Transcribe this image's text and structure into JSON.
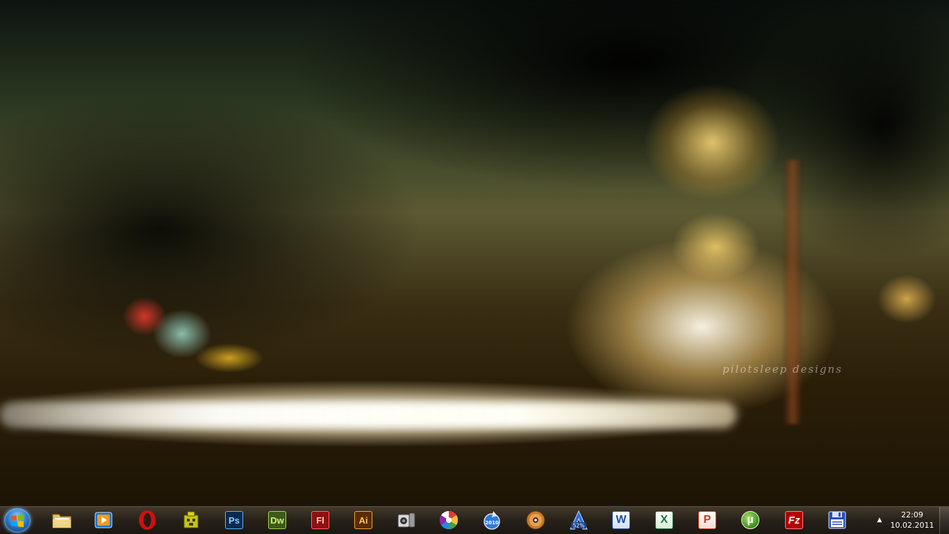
{
  "desktop": {
    "watermark_text": "pilotsleep designs"
  },
  "taskbar": {
    "start_icon": "windows-logo-icon",
    "pinned": [
      {
        "id": "explorer",
        "icon": "folder-icon",
        "text": ""
      },
      {
        "id": "media-player",
        "icon": "media-player-icon",
        "text": ""
      },
      {
        "id": "opera",
        "icon": "opera-icon",
        "text": ""
      },
      {
        "id": "app4",
        "icon": "yellow-app-icon",
        "text": ""
      },
      {
        "id": "photoshop",
        "icon": "photoshop-icon",
        "text": "Ps"
      },
      {
        "id": "dreamweaver",
        "icon": "dreamweaver-icon",
        "text": "Dw"
      },
      {
        "id": "flash",
        "icon": "flash-icon",
        "text": "Fl"
      },
      {
        "id": "illustrator",
        "icon": "illustrator-icon",
        "text": "Ai"
      },
      {
        "id": "speaker",
        "icon": "speaker-icon",
        "text": ""
      },
      {
        "id": "picasa",
        "icon": "picasa-icon",
        "text": ""
      },
      {
        "id": "app11",
        "icon": "disc-2010-icon",
        "text": "2010"
      },
      {
        "id": "disc",
        "icon": "dvd-icon",
        "text": ""
      },
      {
        "id": "aimp",
        "icon": "letter-a-icon",
        "text": "52%"
      },
      {
        "id": "word",
        "icon": "word-icon",
        "text": "W"
      },
      {
        "id": "excel",
        "icon": "excel-icon",
        "text": "X"
      },
      {
        "id": "powerpoint",
        "icon": "powerpoint-icon",
        "text": "P"
      },
      {
        "id": "utorrent",
        "icon": "utorrent-icon",
        "text": "µ"
      },
      {
        "id": "filezilla",
        "icon": "filezilla-icon",
        "text": "Fz"
      },
      {
        "id": "floppy",
        "icon": "floppy-disk-icon",
        "text": ""
      }
    ],
    "tray": {
      "time": "22:09",
      "date": "10.02.2011"
    }
  },
  "colors": {
    "photoshop": "#0b2a4f",
    "dreamweaver": "#3f5a16",
    "flash": "#8e1010",
    "illustrator": "#5a2c00"
  }
}
